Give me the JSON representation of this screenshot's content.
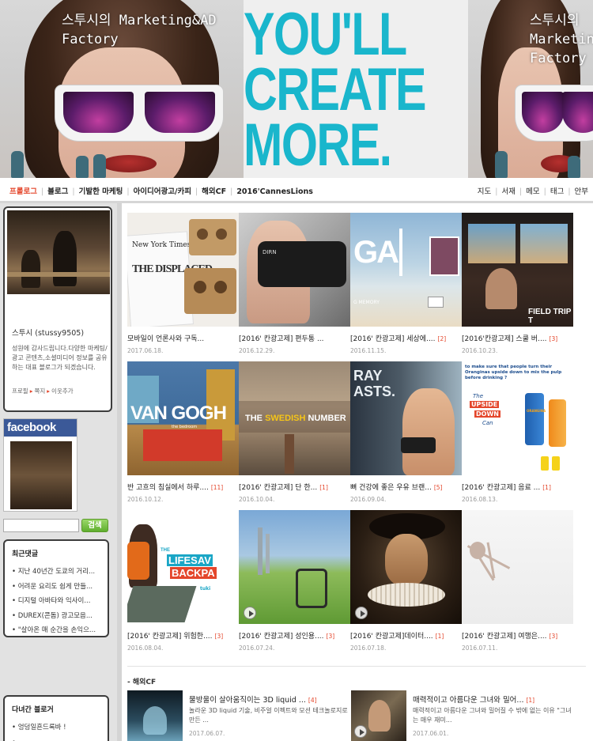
{
  "banner": {
    "blog_title": "스투시의 Marketing&AD Factory",
    "slogan_lines": [
      "YOU'LL",
      "CREATE",
      "MORE."
    ]
  },
  "nav": {
    "left": [
      "프롤로그",
      "블로그",
      "기발한 마케팅",
      "아이디어광고/카피",
      "해외CF",
      "2016'CannesLions"
    ],
    "right": [
      "지도",
      "서재",
      "메모",
      "태그",
      "안부"
    ]
  },
  "sidebar": {
    "profile_name": "스투시 (stussy9505)",
    "profile_desc": "성원에 감사드립니다.다양한 마케팅/광고 콘텐츠,소셜미디어 정보를 공유하는 대표 블로그가 되겠습니다.",
    "profile_links": [
      "프로필",
      "쪽지",
      "이웃추가"
    ],
    "facebook_label": "facebook",
    "search_button": "검색",
    "recent_comments_title": "최근댓글",
    "recent_comments": [
      "지난 40년간 도쿄의 거리...",
      "어려운 요리도 쉽게 만들...",
      "디지털 아바타와 익사이...",
      "DUREX(콘돔) 광고모음...",
      "\"살아온 매 순간을 손익으..."
    ],
    "visitors_title": "다녀간 블로거",
    "visitors": [
      "엉덩일흔드록바 !",
      ""
    ]
  },
  "posts": [
    {
      "title": "모바일이 언론사와 구독...",
      "count": "",
      "date": "2017.06.18."
    },
    {
      "title": "[2016' 칸광고제] 편두통 ...",
      "count": "",
      "date": "2016.12.29."
    },
    {
      "title": "[2016' 칸광고제] 세상에....",
      "count": "[2]",
      "date": "2016.11.15."
    },
    {
      "title": "[2016'칸광고제] 스쿨 버....",
      "count": "[3]",
      "date": "2016.10.23."
    },
    {
      "title": "반 고흐의 침실에서 하루....",
      "count": "[11]",
      "date": "2016.10.12."
    },
    {
      "title": "[2016' 칸광고제] 단 한...",
      "count": "[1]",
      "date": "2016.10.04."
    },
    {
      "title": "뼈 건강에 좋은 우유 브랜...",
      "count": "[5]",
      "date": "2016.09.04."
    },
    {
      "title": "[2016' 칸광고제] 음료 ...",
      "count": "[1]",
      "date": "2016.08.13."
    },
    {
      "title": "[2016' 칸광고제] 위험한....",
      "count": "[3]",
      "date": "2016.08.04."
    },
    {
      "title": "[2016' 칸광고제] 성인용....",
      "count": "[3]",
      "date": "2016.07.24."
    },
    {
      "title": "[2016' 칸광고제]데이터....",
      "count": "[1]",
      "date": "2016.07.18."
    },
    {
      "title": "[2016' 칸광고제] 여행은....",
      "count": "[3]",
      "date": "2016.07.11."
    }
  ],
  "thumb_captions": {
    "nyt": "New York Times",
    "displaced": "THE DISPLACED",
    "dirn": "DIRN",
    "ga": "GA",
    "memory": "G MEMORY",
    "fieldtrip": "FIELD TRIP T",
    "vangogh": "VAN GOGH",
    "vangogh_sub": "the bedroom",
    "swedish_pre": "THE ",
    "swedish_hl": "SWEDISH",
    "swedish_post": " NUMBER",
    "ray": "RAY",
    "asts": "ASTS.",
    "oran_head": "to make sure that people turn their Oranginas upside down to mix the pulp before drinking ?",
    "oran_sign1": "The",
    "oran_sign2": "UPSIDE",
    "oran_sign3": "DOWN",
    "oran_sign4": "Can",
    "oran_can": "ORANGINA",
    "life1": "THE",
    "life2": "LIFESAV",
    "life3": "BACKPA",
    "tuki": "tuki"
  },
  "section_label": "- 해외CF",
  "mini_posts": [
    {
      "title": "물방울이 살아움직이는 3D liquid ...",
      "count": "[4]",
      "desc": "놀라운 3D liquid 기술, 비주얼 이펙트와 모션 테크놀로지로 만든 ...",
      "date": "2017.06.07."
    },
    {
      "title": "매력적이고 아름다운 그녀와 밀어...",
      "count": "[1]",
      "desc": "매력적이고 아름다운 그녀와 밀어질 수 밖에 없는 이유 \"그녀는 매우 재미...",
      "date": "2017.06.01."
    }
  ],
  "colors": {
    "accent": "#e4462b",
    "slogan": "#19b6cc",
    "facebook": "#3b5998",
    "search_button": "#5fae2e"
  }
}
